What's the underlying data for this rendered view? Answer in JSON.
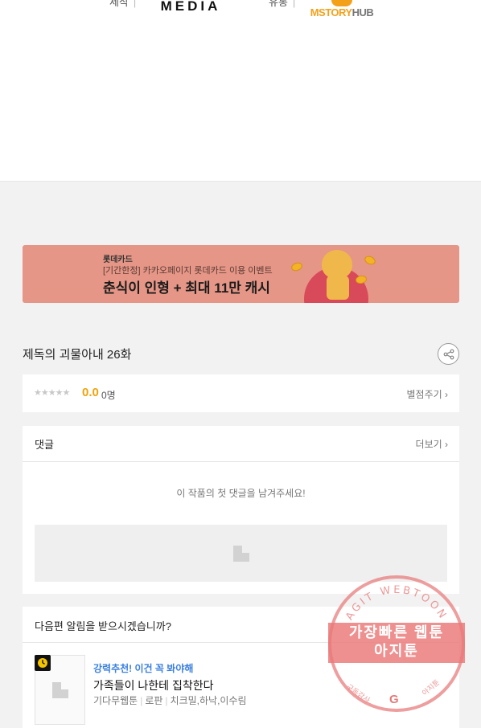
{
  "credits": {
    "production_label": "제작",
    "production_logo": "MEDIA",
    "distribution_label": "유통",
    "distribution_logo_main": "MSTORY",
    "distribution_logo_suffix": "HUB"
  },
  "banner": {
    "brand": "롯데카드",
    "subtitle": "[기간한정] 카카오페이지 롯데카드 이용 이벤트",
    "headline": "춘식이 인형 + 최대 11만 캐시"
  },
  "episode": {
    "title": "제독의 괴물아내 26화"
  },
  "rating": {
    "stars": "★★★★★",
    "score": "0.0",
    "count": "0명",
    "rate_link": "별점주기 ›"
  },
  "comments": {
    "title": "댓글",
    "more": "더보기 ›",
    "empty_message": "이 작품의 첫 댓글을 남겨주세요!"
  },
  "notify": {
    "title": "다음편 알림을 받으시겠습니까?",
    "recommendation": {
      "promo": "강력추천! 이건 꼭 봐야해",
      "title": "가족들이 나한테 집착한다",
      "type": "기다무웹툰",
      "genre": "로판",
      "authors": "치크밀,하낙,이수림"
    }
  },
  "watermark": {
    "arc_text": "AGIT WEBTOON",
    "line1": "가장빠른 웹툰",
    "line2": "아지툰",
    "bottom_left": "구독감사",
    "bottom_right": "아지툰"
  },
  "colors": {
    "banner_bg": "#e59686",
    "score": "#f0a30a",
    "promo": "#3a7fe0",
    "stamp": "#e87e7e"
  }
}
